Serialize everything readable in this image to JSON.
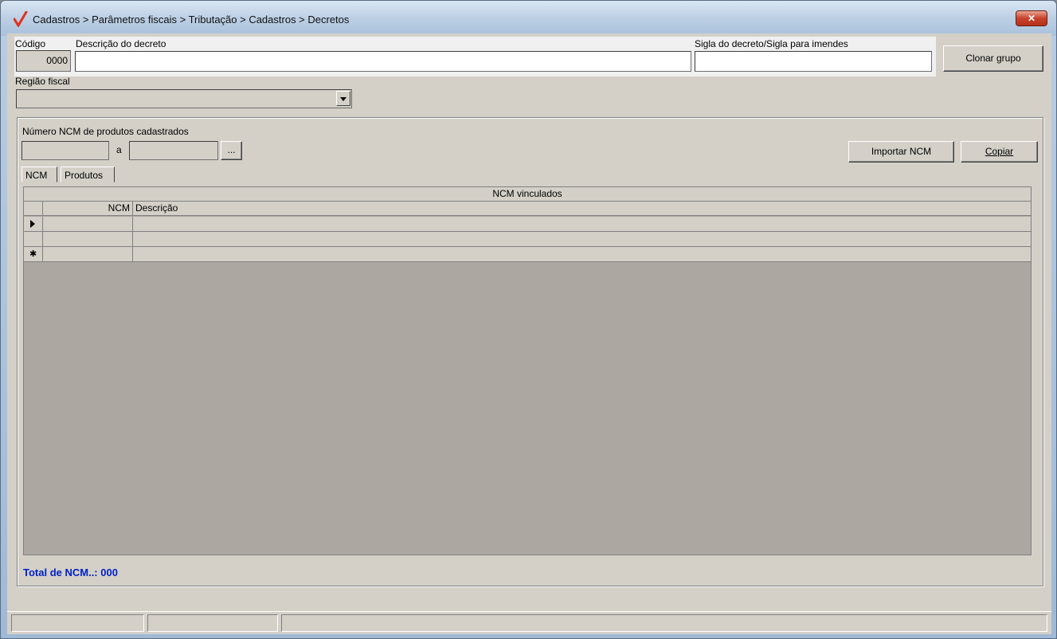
{
  "window": {
    "title": "Cadastros > Parâmetros fiscais > Tributação > Cadastros > Decretos",
    "close_label": "✕",
    "accent": "#e0301e"
  },
  "form": {
    "codigo_label": "Código",
    "codigo_value": "0000",
    "descricao_label": "Descrição do decreto",
    "descricao_value": "",
    "sigla_label": "Sigla do decreto/Sigla para imendes",
    "sigla_value": "",
    "clonar_button": "Clonar grupo",
    "regiao_label": "Região fiscal",
    "regiao_value": ""
  },
  "ncm_filter": {
    "label": "Número  NCM de produtos cadastrados",
    "from_value": "",
    "sep": "a",
    "to_value": "",
    "browse_button": "...",
    "importar_button": "Importar NCM",
    "copiar_button": "Copiar"
  },
  "tabs": [
    {
      "label": "NCM"
    },
    {
      "label": "Produtos"
    }
  ],
  "grid": {
    "title": "NCM vinculados",
    "columns": [
      "NCM",
      "Descrição"
    ],
    "rows": [
      {
        "indicator": "current",
        "ncm": "",
        "descricao": ""
      },
      {
        "indicator": "",
        "ncm": "",
        "descricao": ""
      },
      {
        "indicator": "new",
        "ncm": "",
        "descricao": ""
      }
    ]
  },
  "footer": {
    "total_label": "Total de NCM..: 000"
  }
}
